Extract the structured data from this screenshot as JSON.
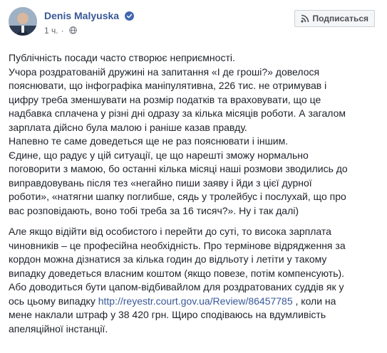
{
  "author": {
    "name": "Denis Malyuska",
    "verified": true,
    "time": "1 ч.",
    "privacy_icon": "globe-icon"
  },
  "subscribe_button": {
    "label": "Подписаться",
    "icon": "rss-icon"
  },
  "post": {
    "lines_block1": [
      "Публічність посади часто створює неприємності.",
      "Учора роздратованій дружині на запитання «І де гроші?» довелося",
      "пояснювати, що інфографіка маніпулятивна, 226 тис. не отримував і",
      "цифру треба зменшувати на розмір податків та враховувати, що це",
      "надбавка сплачена у різні дні одразу за кілька місяців роботи. А загалом",
      "зарплата дійсно була малою і раніше казав правду.",
      "Напевно те саме доведеться ще не раз пояснювати і іншим.",
      "Єдине, що радує у цій ситуації, це що нарешті зможу нормально",
      "поговорити з мамою, бо останні кілька місяці наші розмови зводились до",
      "виправдовувань після тез «негайно пиши заяву і йди з цієї дурної",
      "роботи», «натягни шапку поглибше, сядь у тролейбус і послухай, що про",
      "вас розповідають, воно тобі треба за 16 тисяч?». Ну і так далі)"
    ],
    "lines_block2": [
      "Але якщо відійти від особистого і перейти до суті, то висока зарплата",
      "чиновників – це професійна необхідність. Про термінове відрядження за",
      "кордон можна дізнатися за кілька годин до відльоту і летіти у такому",
      "випадку доведеться власним коштом (якщо повезе, потім компенсують).",
      "Або доводиться бути цапом-відбивайлом для роздратованих суддів як у"
    ],
    "link_line_prefix": "ось цьому випадку ",
    "link_text": "http://reyestr.court.gov.ua/Review/86457785",
    "link_line_suffix": " , коли на",
    "lines_block2_end": [
      "мене наклали штраф у 38 420 грн. Щиро сподіваюсь на вдумливість",
      "апеляційної інстанції."
    ]
  },
  "colors": {
    "name": "#385898",
    "link": "#385898",
    "verified_badge": "#4267b2",
    "text": "#1d2129",
    "meta": "#606770"
  }
}
